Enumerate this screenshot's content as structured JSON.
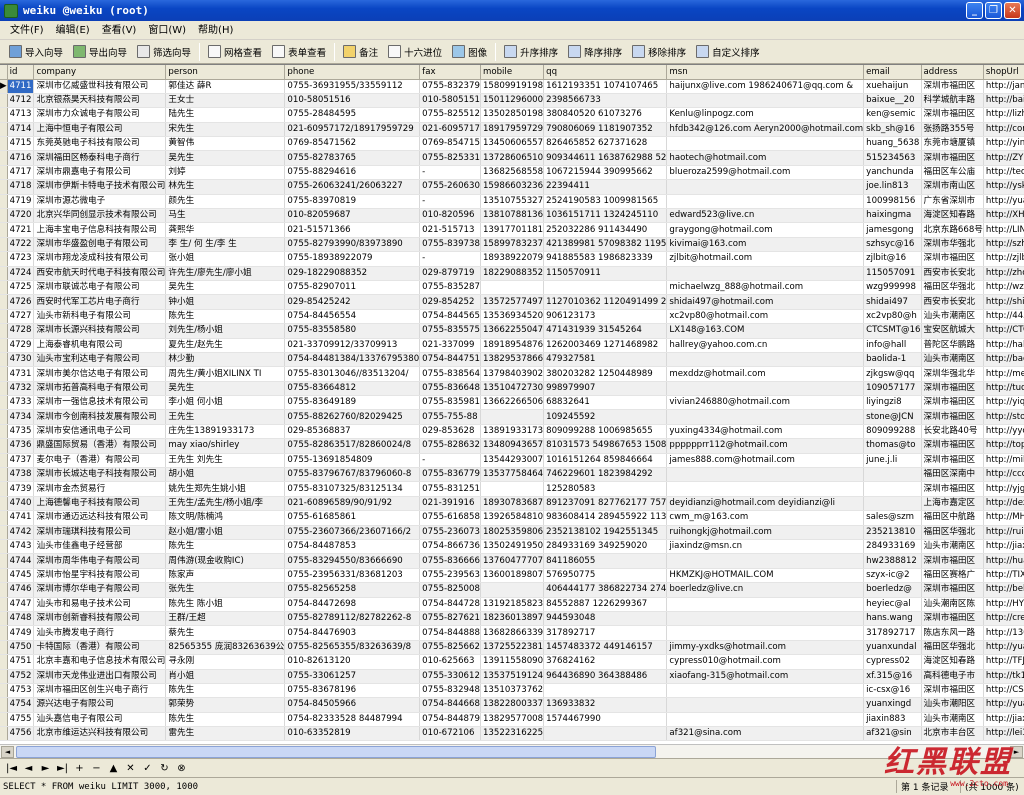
{
  "window": {
    "title": "weiku @weiku (root)"
  },
  "menu": [
    "文件(F)",
    "编辑(E)",
    "查看(V)",
    "窗口(W)",
    "帮助(H)"
  ],
  "toolbar": [
    {
      "label": "导入向导",
      "icon": "import-icon"
    },
    {
      "label": "导出向导",
      "icon": "export-icon"
    },
    {
      "label": "筛选向导",
      "icon": "filter-icon"
    },
    {
      "label": "网格查看",
      "icon": "grid-view-icon"
    },
    {
      "label": "表单查看",
      "icon": "form-view-icon"
    },
    {
      "label": "备注",
      "icon": "memo-icon"
    },
    {
      "label": "十六进位",
      "icon": "hex-icon"
    },
    {
      "label": "图像",
      "icon": "image-icon"
    },
    {
      "label": "升序排序",
      "icon": "sort-asc-icon"
    },
    {
      "label": "降序排序",
      "icon": "sort-desc-icon"
    },
    {
      "label": "移除排序",
      "icon": "remove-sort-icon"
    },
    {
      "label": "自定义排序",
      "icon": "custom-sort-icon"
    }
  ],
  "columns": [
    "id",
    "company",
    "person",
    "phone",
    "fax",
    "mobile",
    "qq",
    "msn",
    "email",
    "address",
    "shopUrl"
  ],
  "rows": [
    [
      "4711",
      "深圳市亿威盛世科技有限公司",
      "郭佳达 薛R",
      "0755-36931955/33559112",
      "0755-832379",
      "15809919198",
      "1612193351 1074107465",
      "haijunx@live.com 1986240671@qq.com &",
      "xuehaijun",
      "深圳市福田区",
      "http://janek"
    ],
    [
      "4712",
      "北京银燕昊天科技有限公司",
      "王女士",
      "010-58051516",
      "010-5805151",
      "15011296000",
      "2398566733",
      "",
      "baixue__20",
      "科学城航丰路",
      "http://baixu"
    ],
    [
      "4713",
      "深圳市力众诚电子有限公司",
      "陆先生",
      "0755-28484595",
      "0755-825512",
      "13502850198",
      "380840520 61073276",
      "Kenlu@linpogz.com",
      "ken@semic",
      "深圳市福田区",
      "http://lizho"
    ],
    [
      "4714",
      "上海中恒电子有限公司",
      "宋先生",
      "021-60957172/18917959729",
      "021-6095717",
      "18917959729",
      "790806069 1181907352",
      "hfdb342@126.com Aeryn2000@hotmail.com",
      "skb_sh@16",
      "张扬路355号",
      "http://consc"
    ],
    [
      "4715",
      "东莞英驰电子科技有限公司",
      "黄智伟",
      "0769-85471562",
      "0769-854715",
      "13450606557",
      "826465852 627371628",
      "",
      "huang_5638",
      "东莞市塘厦镇",
      "http://yingc"
    ],
    [
      "4716",
      "深圳福田区畅泰科电子商行",
      "吴先生",
      "0755-82783765",
      "0755-825331",
      "13728606510",
      "909344611 1638762988 52",
      "haotech@hotmail.com",
      "515234563",
      "深圳市福田区",
      "http://ZYD22"
    ],
    [
      "4717",
      "深圳市鼎嘉电子有限公司",
      "刘婷",
      "0755-88294616",
      "-",
      "13682568558",
      "1067215944 390995662",
      "blueroza2599@hotmail.com",
      "yanchunda",
      "福田区车公庙",
      "http://tecwo"
    ],
    [
      "4718",
      "深圳市伊斯卡特电子技术有限公司",
      "林先生",
      "0755-26063241/26063227",
      "0755-260630",
      "15986603236",
      "22394411",
      "",
      "joe.lin813",
      "深圳市南山区",
      "http://yskt_"
    ],
    [
      "4719",
      "深圳市源芯微电子",
      "颜先生",
      "0755-83970819",
      "-",
      "13510755327",
      "2524190583 1009981565",
      "",
      "100998156",
      "广东省深圳市",
      "http://yuanx"
    ],
    [
      "4720",
      "北京兴华同创显示技术有限公司",
      "马生",
      "010-82059687",
      "010-820596",
      "13810788136",
      "1036151711 1324245110",
      "edward523@live.cn",
      "haixingma",
      "海淀区知春路",
      "http://XHTCX"
    ],
    [
      "4721",
      "上海丰宝电子信息科技有限公司",
      "龚熙华",
      "021-51571366",
      "021-515713",
      "13917701181",
      "252032286 911434490",
      "graygong@hotmail.com",
      "jamesgong",
      "北京东路668号",
      "http://LINFO"
    ],
    [
      "4722",
      "深圳市华盛盈创电子有限公司",
      "李 生/ 何 生/李 生",
      "0755-82793990/83973890",
      "0755-839738",
      "15899783237",
      "421389981 57098382 1195",
      "kivimai@163.com",
      "szhsyc@16",
      "深圳市华强北",
      "http://szhsy"
    ],
    [
      "4723",
      "深圳市翔龙凌成科技有限公司",
      "张小姐",
      "0755-18938922079",
      "-",
      "18938922079",
      "941885583 1986823339",
      "zjlbit@hotmail.com",
      "zjlbit@16",
      "深圳市福田区",
      "http://zjlbi"
    ],
    [
      "4724",
      "西安市航天时代电子科技有限公司",
      "许先生/廖先生/廖小姐",
      "029-18229088352",
      "029-879719",
      "18229088352",
      "1150570911",
      "",
      "115057091",
      "西安市长安北",
      "http://zhouz"
    ],
    [
      "4725",
      "深圳市联诚芯电子有限公司",
      "吴先生",
      "0755-82907011",
      "0755-835287",
      "",
      "",
      "michaelwzg_888@hotmail.com",
      "wzg999998",
      "福田区华强北",
      "http://wzg99"
    ],
    [
      "4726",
      "西安时代军工芯片电子商行",
      "钟小姐",
      "029-85425242",
      "029-854252",
      "13572577497",
      "1127010362 1120491499 2",
      "shidai497@hotmail.com",
      "shidai497",
      "西安市长安北",
      "http://shida"
    ],
    [
      "4727",
      "汕头市新科电子有限公司",
      "陈先生",
      "0754-84456554",
      "0754-844565",
      "13536934520",
      "906123173",
      "xc2vp80@hotmail.com",
      "xc2vp80@h",
      "汕头市潮南区",
      "http://44565"
    ],
    [
      "4728",
      "深圳市长源兴科技有限公司",
      "刘先生/杨小姐",
      "0755-83558580",
      "0755-835575",
      "13662255047",
      "471431939 31545264",
      "LX148@163.COM",
      "CTCSMT@16",
      "宝安区航城大",
      "http://CTCDZ"
    ],
    [
      "4729",
      "上海泰睿机电有限公司",
      "夏先生/赵先生",
      "021-33709912/33709913",
      "021-337099",
      "18918954876",
      "1262003469 1271468982",
      "hallrey@yahoo.com.cn",
      "info@hall",
      "普陀区华鹏路",
      "http://hallr"
    ],
    [
      "4730",
      "汕头市宝利达电子有限公司",
      "林少勤",
      "0754-84481384/13376795380",
      "0754-844751",
      "13829537866",
      "479327581",
      "",
      "baolida-1",
      "汕头市潮南区",
      "http://baoli"
    ],
    [
      "4731",
      "深圳市美尔信达电子有限公司",
      "周先生/黄小姐XILINX TI",
      "0755-83013046//83513204/",
      "0755-838564",
      "13798403902",
      "380203282 1250448989",
      "mexddz@hotmail.com",
      "zjkgsw@qq",
      "深圳华强北华",
      "http://mexdd"
    ],
    [
      "4732",
      "深圳市拓普高科电子有限公司",
      "吴先生",
      "0755-83664812",
      "0755-836648",
      "13510472730",
      "998979907",
      "",
      "109057177",
      "深圳市福田区",
      "http://tuopu"
    ],
    [
      "4733",
      "深圳市一强信息技术有限公司",
      "李小姐 何小姐",
      "0755-83649189",
      "0755-835981",
      "13662266506",
      "68832641",
      "vivian246880@hotmail.com",
      "liyingzi8",
      "深圳市福田区",
      "http://yiqia"
    ],
    [
      "4734",
      "深圳市今创南科技发展有限公司",
      "王先生",
      "0755-88262760/82029425",
      "0755-755-88",
      "",
      "109245592",
      "",
      "stone@JCN",
      "深圳市福田区",
      "http://stone"
    ],
    [
      "4735",
      "深圳市安信通讯电子公司",
      "庄先生13891933173",
      "029-85368837",
      "029-853628",
      "13891933173",
      "809099288 1006985655",
      "yuxing4334@hotmail.com",
      "809099288",
      "长安北路40号",
      "http://yycyd"
    ],
    [
      "4736",
      "鼎盛国际贸易（香港）有限公司",
      "may xiao/shirley",
      "0755-82863517/82860024/8",
      "0755-828632",
      "13480943657",
      "81031573 549867653 1508",
      "pppppprr112@hotmail.com",
      "thomas@to",
      "深圳市福田区",
      "http://topra"
    ],
    [
      "4737",
      "麦尔电子（香港）有限公司",
      "王先生 刘先生",
      "0755-13691854809",
      "-",
      "13544293007",
      "1016151264 859846664",
      "james888.com@hotmail.com",
      "june.j.li",
      "深圳市福田区",
      "http://mile."
    ],
    [
      "4738",
      "深圳市长城达电子科技有限公司",
      "胡小姐",
      "0755-83796767/83796060-8",
      "0755-836779",
      "13537758464",
      "746229601 1823984292",
      "",
      "",
      "福田区深南中",
      "http://ccd.d"
    ],
    [
      "4739",
      "深圳市金杰贸易行",
      "姚先生郑先生姚小姐",
      "0755-83107325/83125134",
      "0755-831251",
      "",
      "125280583",
      "",
      "",
      "深圳市福田区",
      "http://yjgdf"
    ],
    [
      "4740",
      "上海德馨电子科技有限公司",
      "王先生/孟先生/杨小姐/李",
      "021-60896589/90/91/92",
      "021-391916",
      "18930783687",
      "891237091 827762177 757",
      "deyidianzi@hotmail.com deyidianzi@li",
      "",
      "上海市嘉定区",
      "http://dexin"
    ],
    [
      "4741",
      "深圳市通迈远达科技有限公司",
      "陈文明/陈楠鸿",
      "0755-61685861",
      "0755-616858",
      "13926584810",
      "983608414 289455922 113",
      "cwm_m@163.com",
      "sales@szm",
      "福田区中航路",
      "http://MHDKJ"
    ],
    [
      "4742",
      "深圳市瑞琪科技有限公司",
      "赵小姐/雷小姐",
      "0755-23607366/23607166/2",
      "0755-236073",
      "18025359806",
      "2352138102 1942551345",
      "ruihongkj@hotmail.com",
      "235213810",
      "福田区华强北",
      "http://ruiho"
    ],
    [
      "4743",
      "汕头市佳鑫电子经营部",
      "陈先生",
      "0754-84487853",
      "0754-866736",
      "13502491950",
      "284933169 349259020",
      "jiaxindz@msn.cn",
      "284933169",
      "汕头市潮南区",
      "http://jiaxi"
    ],
    [
      "4744",
      "深圳市周华伟电子有限公司",
      "周伟游(现金收购IC)",
      "0755-83294550/83666690",
      "0755-836666",
      "13760477707",
      "841186055",
      "",
      "hw2388812",
      "深圳市福田区",
      "http://huawe"
    ],
    [
      "4745",
      "深圳市怡星宇科技有限公司",
      "陈家声",
      "0755-23956331/83681203",
      "0755-239563",
      "13600189807",
      "576950775",
      "HKMZKJ@HOTMAIL.COM",
      "szyx-ic@2",
      "福田区赛格广",
      "http://TIXIN"
    ],
    [
      "4746",
      "深圳市博尔华电子有限公司",
      "张先生",
      "0755-82565258",
      "0755-825008",
      "",
      "406444177 386822734 274",
      "boerledz@live.cn",
      "boerledz@",
      "深圳市福田区",
      "http://beldz"
    ],
    [
      "4747",
      "汕头市和易电子技术公司",
      "陈先生 陈小姐",
      "0754-84472698",
      "0754-844728",
      "13192185823",
      "84552887 1226299367",
      "",
      "heyiec@al",
      "汕头潮南区陈",
      "http://HYEC."
    ],
    [
      "4748",
      "深圳市创新睿科技有限公司",
      "王群/王超",
      "0755-82789112/82782262-8",
      "0755-827621",
      "18236013897",
      "944593048",
      "",
      "hans.wang",
      "深圳市福田区",
      "http://creav"
    ],
    [
      "4749",
      "汕头市腾发电子商行",
      "蔡先生",
      "0754-84476903",
      "0754-844888",
      "13682866339",
      "317892717",
      "",
      "317892717",
      "陈店东风一路",
      "http://13682"
    ],
    [
      "4750",
      "卡特国际（香港）有限公司",
      "82565355 庞润83263639公",
      "0755-82565355/83263639/8",
      "0755-825662",
      "13725522381",
      "1457483372 449146157",
      "jimmy-yxdks@hotmail.com",
      "yuanxundal",
      "福田区华强北",
      "http://yuanx"
    ],
    [
      "4751",
      "北京丰嘉和电子信息技术有限公司",
      "寻永刚",
      "010-82613120",
      "010-625663",
      "13911558090",
      "376824162",
      "cypress010@hotmail.com",
      "cypress02",
      "海淀区知春路",
      "http://TFJH6"
    ],
    [
      "4752",
      "深圳市天龙伟业进出口有限公司",
      "肖小姐",
      "0755-33061257",
      "0755-330612",
      "13537519124",
      "964436890 364388486",
      "xiaofang-315@hotmail.com",
      "xf.315@16",
      "高科德电子市",
      "http://tk100"
    ],
    [
      "4753",
      "深圳市福田区创生兴电子商行",
      "陈先生",
      "0755-83678196",
      "0755-832948",
      "13510373762",
      "",
      "",
      "ic-csx@16",
      "深圳市福田区",
      "http://CSX.d"
    ],
    [
      "4754",
      "源兴达电子有限公司",
      "郭荣势",
      "0754-84505966",
      "0754-844668",
      "13822800337",
      "136933832",
      "",
      "yuanxingd",
      "汕头市潮阳区",
      "http://yuanx"
    ],
    [
      "4755",
      "汕头嘉信电子有限公司",
      "陈先生",
      "0754-82333528 84487994",
      "0754-844879",
      "13829577008",
      "1574467990",
      "",
      "jiaxin883",
      "汕头市潮南区",
      "http://jiaxi"
    ],
    [
      "4756",
      "北京市维运达兴科技有限公司",
      "雷先生",
      "010-63352819",
      "010-672106",
      "13522316225",
      "",
      "af321@sina.com",
      "af321@sin",
      "北京市丰台区",
      "http://lei32"
    ]
  ],
  "navigator": [
    "|◄",
    "◄",
    "►",
    "►|",
    "+",
    "−",
    "▲",
    "✕",
    "✓",
    "↻",
    "⊗"
  ],
  "status": {
    "sql": "SELECT * FROM  weiku  LIMIT 3000, 1000",
    "record": "第 1 条记录",
    "pages": "(共 1000 条)"
  },
  "watermark": {
    "text": "红黑联盟",
    "sub": "www.2cto.com"
  },
  "colors": {
    "titlebar": "#0a46c4",
    "selection": "#316ac5",
    "watermark": "#c8141e"
  }
}
